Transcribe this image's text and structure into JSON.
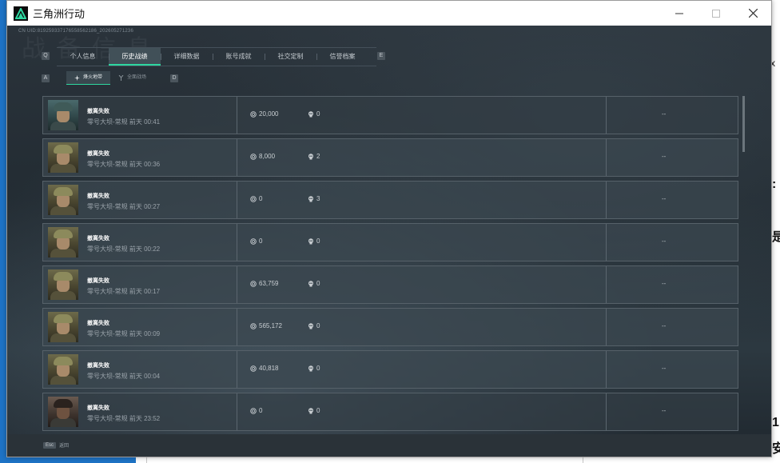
{
  "window": {
    "title": "三角洲行动",
    "accent": "#2ed7a0"
  },
  "header": {
    "uid": "CN UID:819259337176558562186_202605271236",
    "bg_title": "战备信息"
  },
  "tabs": {
    "prev_key": "Q",
    "next_key": "E",
    "items": [
      {
        "label": "个人信息",
        "active": false
      },
      {
        "label": "历史战绩",
        "active": true
      },
      {
        "label": "详细数据",
        "active": false
      },
      {
        "label": "账号成就",
        "active": false
      },
      {
        "label": "社交定制",
        "active": false
      },
      {
        "label": "信誉档案",
        "active": false
      }
    ]
  },
  "subtabs": {
    "prev_key": "A",
    "next_key": "D",
    "items": [
      {
        "label": "烽火地带",
        "icon": "hazard-icon",
        "active": true
      },
      {
        "label": "全面战场",
        "icon": "battlefield-icon",
        "active": false
      }
    ]
  },
  "matches": [
    {
      "result": "撤离失败",
      "meta": "零号大坝-常规 前天 00:41",
      "coins": "20,000",
      "kills": "0",
      "extra": "--",
      "avatar": "alt"
    },
    {
      "result": "撤离失败",
      "meta": "零号大坝-常规 前天 00:36",
      "coins": "8,000",
      "kills": "2",
      "extra": "--",
      "avatar": "camo"
    },
    {
      "result": "撤离失败",
      "meta": "零号大坝-常规 前天 00:27",
      "coins": "0",
      "kills": "3",
      "extra": "--",
      "avatar": "camo"
    },
    {
      "result": "撤离失败",
      "meta": "零号大坝-常规 前天 00:22",
      "coins": "0",
      "kills": "0",
      "extra": "--",
      "avatar": "camo"
    },
    {
      "result": "撤离失败",
      "meta": "零号大坝-常规 前天 00:17",
      "coins": "63,759",
      "kills": "0",
      "extra": "--",
      "avatar": "camo"
    },
    {
      "result": "撤离失败",
      "meta": "零号大坝-常规 前天 00:09",
      "coins": "565,172",
      "kills": "0",
      "extra": "--",
      "avatar": "camo"
    },
    {
      "result": "撤离失败",
      "meta": "零号大坝-常规 前天 00:04",
      "coins": "40,818",
      "kills": "0",
      "extra": "--",
      "avatar": "camo"
    },
    {
      "result": "撤离失败",
      "meta": "零号大坝-常规 前天 23:52",
      "coins": "0",
      "kills": "0",
      "extra": "--",
      "avatar": "alt2"
    }
  ],
  "footer": {
    "esc_key": "Esc",
    "esc_label": "返回"
  },
  "desktop": {
    "frag1": "x",
    "frag2": ":",
    "frag3": "是",
    "frag4": "1",
    "frag5": "安"
  }
}
